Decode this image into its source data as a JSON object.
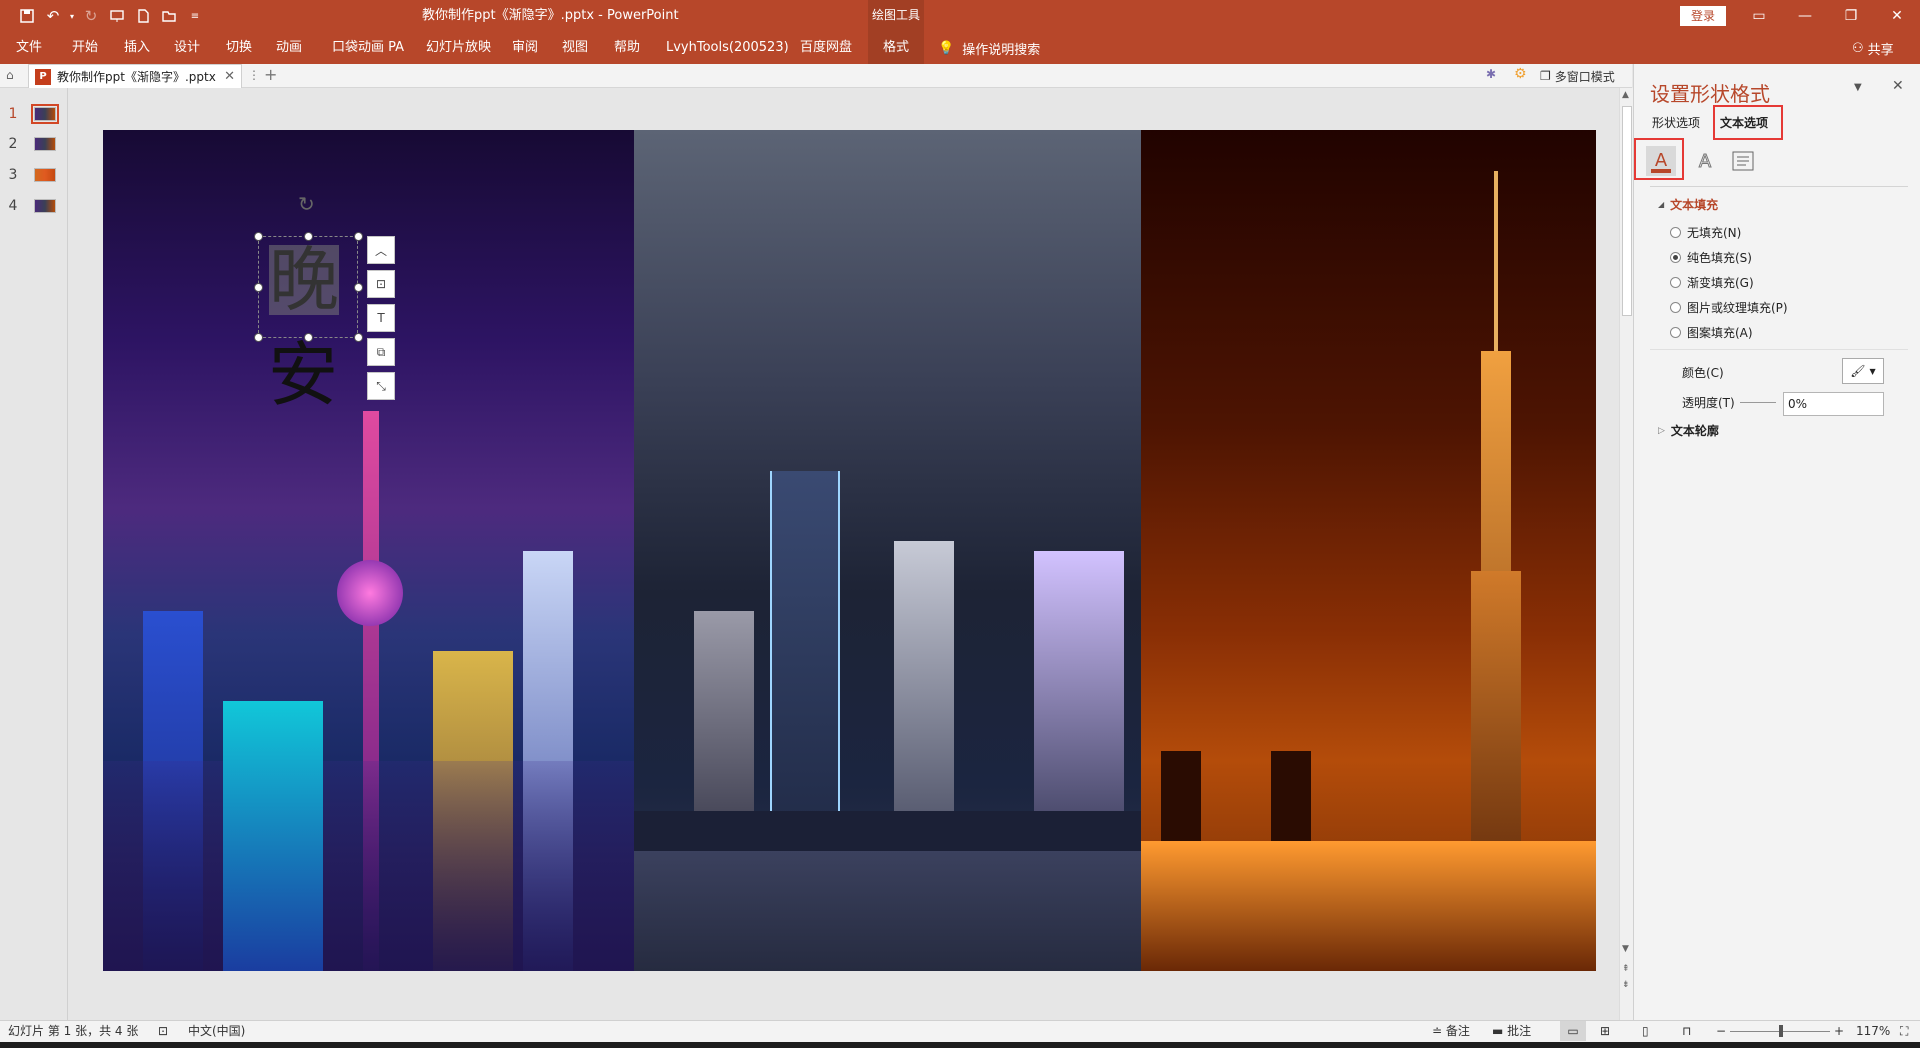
{
  "titlebar": {
    "doc_title": "教你制作ppt《渐隐字》.pptx - PowerPoint",
    "context_tool": "绘图工具",
    "login": "登录"
  },
  "ribbon": {
    "tabs": [
      "文件",
      "开始",
      "插入",
      "设计",
      "切换",
      "动画",
      "口袋动画 PA",
      "幻灯片放映",
      "审阅",
      "视图",
      "帮助",
      "LvyhTools(200523)",
      "百度网盘",
      "格式"
    ],
    "search": "操作说明搜索",
    "share": "共享"
  },
  "docbar": {
    "tab_name": "教你制作ppt《渐隐字》.pptx",
    "multiwin": "多窗口模式"
  },
  "thumbnails": [
    "1",
    "2",
    "3",
    "4"
  ],
  "slide": {
    "char1": "晚",
    "char2": "安"
  },
  "pane": {
    "title": "设置形状格式",
    "tab_shape": "形状选项",
    "tab_text": "文本选项",
    "section_fill": "文本填充",
    "options": [
      "无填充(N)",
      "纯色填充(S)",
      "渐变填充(G)",
      "图片或纹理填充(P)",
      "图案填充(A)"
    ],
    "selected_option": 1,
    "color_label": "颜色(C)",
    "transparency_label": "透明度(T)",
    "transparency_value": "0%",
    "section_outline": "文本轮廓"
  },
  "statusbar": {
    "slide_info": "幻灯片 第 1 张，共 4 张",
    "language": "中文(中国)",
    "notes": "备注",
    "comments": "批注",
    "zoom": "117%"
  },
  "colors": {
    "accent": "#b7472a",
    "highlight": "#e53935"
  }
}
